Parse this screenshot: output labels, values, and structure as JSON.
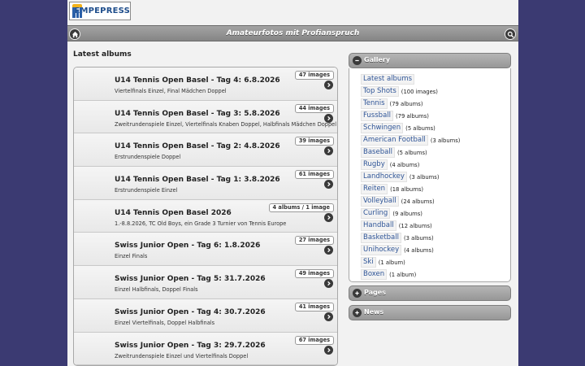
{
  "logo": {
    "text": "EMPEPRESS"
  },
  "header": {
    "title": "Amateurfotos mit Profianspruch"
  },
  "latest": {
    "heading": "Latest albums",
    "albums": [
      {
        "title": "U14 Tennis Open Basel - Tag 4: 6.8.2026",
        "desc": "Viertelfinals Einzel, Final Mädchen Doppel",
        "count": "47 images"
      },
      {
        "title": "U14 Tennis Open Basel - Tag 3: 5.8.2026",
        "desc": "Zweitrundenspiele Einzel, Viertelfinals Knaben Doppel, Halbfinals Mädchen Doppel",
        "count": "44 images"
      },
      {
        "title": "U14 Tennis Open Basel - Tag 2: 4.8.2026",
        "desc": "Erstrundenspiele Doppel",
        "count": "39 images"
      },
      {
        "title": "U14 Tennis Open Basel - Tag 1: 3.8.2026",
        "desc": "Erstrundenspiele Einzel",
        "count": "61 images"
      },
      {
        "title": "U14 Tennis Open Basel 2026",
        "desc": "1.-8.8.2026, TC Old Boys, ein Grade 3 Turnier von Tennis Europe",
        "count": "4 albums / 1 image"
      },
      {
        "title": "Swiss Junior Open - Tag 6: 1.8.2026",
        "desc": "Einzel Finals",
        "count": "27 images"
      },
      {
        "title": "Swiss Junior Open - Tag 5: 31.7.2026",
        "desc": "Einzel Halbfinals, Doppel Finals",
        "count": "49 images"
      },
      {
        "title": "Swiss Junior Open - Tag 4: 30.7.2026",
        "desc": "Einzel Viertelfinals, Doppel Halbfinals",
        "count": "41 images"
      },
      {
        "title": "Swiss Junior Open - Tag 3: 29.7.2026",
        "desc": "Zweitrundenspiele Einzel und Viertelfinals Doppel",
        "count": "67 images"
      }
    ]
  },
  "gallery": {
    "heading": "Gallery",
    "items": [
      {
        "label": "Latest albums",
        "count": ""
      },
      {
        "label": "Top Shots",
        "count": "(100 images)"
      },
      {
        "label": "Tennis",
        "count": "(79 albums)"
      },
      {
        "label": "Fussball",
        "count": "(79 albums)"
      },
      {
        "label": "Schwingen",
        "count": "(5 albums)"
      },
      {
        "label": "American Football",
        "count": "(3 albums)"
      },
      {
        "label": "Baseball",
        "count": "(5 albums)"
      },
      {
        "label": "Rugby",
        "count": "(4 albums)"
      },
      {
        "label": "Landhockey",
        "count": "(3 albums)"
      },
      {
        "label": "Reiten",
        "count": "(18 albums)"
      },
      {
        "label": "Volleyball",
        "count": "(24 albums)"
      },
      {
        "label": "Curling",
        "count": "(9 albums)"
      },
      {
        "label": "Handball",
        "count": "(12 albums)"
      },
      {
        "label": "Basketball",
        "count": "(3 albums)"
      },
      {
        "label": "Unihockey",
        "count": "(4 albums)"
      },
      {
        "label": "Ski",
        "count": "(1 album)"
      },
      {
        "label": "Boxen",
        "count": "(1 album)"
      }
    ]
  },
  "pages": {
    "heading": "Pages"
  },
  "news": {
    "heading": "News"
  },
  "icons": {
    "home": "home-icon",
    "search": "search-icon",
    "album_arrow": "chevron-right-icon",
    "gallery_toggle": "minus-icon",
    "pages_toggle": "plus-icon",
    "news_toggle": "plus-icon"
  },
  "colors": {
    "background": "#3b3a72",
    "link": "#2f5597",
    "header": "#959595"
  }
}
